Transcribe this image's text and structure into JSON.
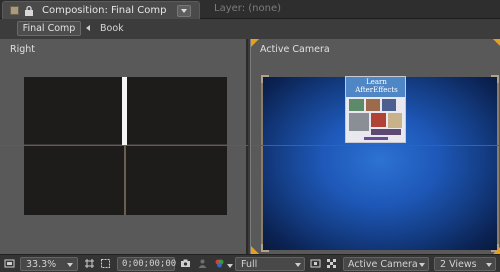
{
  "tabs": {
    "active_title": "Composition: Final Comp",
    "inactive_title": "Layer: (none)"
  },
  "flowchart": {
    "current": "Final Comp",
    "parent": "Book"
  },
  "views": {
    "left_label": "Right",
    "right_label": "Active Camera"
  },
  "book_cover": {
    "title_line1": "Learn",
    "title_line2": "AfterEffects"
  },
  "toolbar": {
    "zoom": "33.3%",
    "timecode": "0;00;00;00",
    "resolution": "Full",
    "camera": "Active Camera",
    "view_layout": "2 Views"
  },
  "colors": {
    "accent_orange": "#e6a020",
    "guide_red": "#b03a3a",
    "camera_blue": "#1e58b8"
  }
}
